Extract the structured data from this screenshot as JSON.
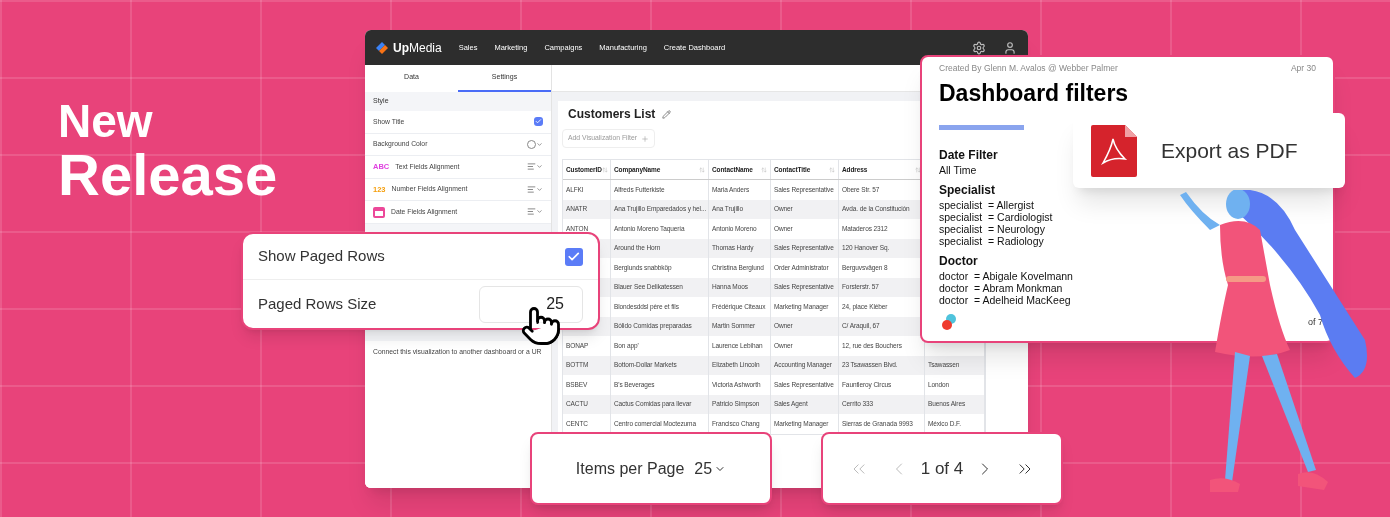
{
  "headline": {
    "line_1": "New",
    "line_2": "Release"
  },
  "app": {
    "brand": "**Up**Media",
    "nav": [
      "Sales",
      "Marketing",
      "Campaigns",
      "Manufacturing",
      "Create Dashboard"
    ],
    "panel_tabs": [
      {
        "label": "Data",
        "selected": false
      },
      {
        "label": "Settings",
        "selected": true
      }
    ],
    "settings": {
      "section": "Style",
      "items": [
        {
          "kind": "checkbox",
          "label": "Show Title",
          "checked": true
        },
        {
          "kind": "color",
          "label": "Background Color"
        },
        {
          "kind": "align",
          "label": "Text Fields Alignment",
          "badge": "ABC",
          "color": "#e040e0"
        },
        {
          "kind": "align",
          "label": "Number Fields Alignment",
          "badge": "123",
          "color": "#f59e0b"
        },
        {
          "kind": "align",
          "label": "Date Fields Alignment",
          "color": "#ec4899"
        }
      ],
      "link_note": "Connect this visualization to another dashboard or a UR"
    },
    "visualization": {
      "title": "Customers List",
      "filter_placeholder": "Add Visualization Filter",
      "columns": [
        "CustomerID",
        "CompanyName",
        "ContactName",
        "ContactTitle",
        "Address"
      ],
      "rows": [
        {
          "id": "ALFKI",
          "company": "Alfreds Futterkiste",
          "contact": "Maria Anders",
          "title": "Sales Representative",
          "address": "Obere Str. 57"
        },
        {
          "id": "ANATR",
          "company": "Ana Trujillo Emparedados y hel...",
          "contact": "Ana Trujillo",
          "title": "Owner",
          "address": "Avda. de la Constitución"
        },
        {
          "id": "ANTON",
          "company": "Antonio Moreno Taquería",
          "contact": "Antonio Moreno",
          "title": "Owner",
          "address": "Mataderos 2312"
        },
        {
          "company": "Around the Horn",
          "contact": "Thomas Hardy",
          "title": "Sales Representative",
          "address": "120 Hanover Sq."
        },
        {
          "company": "Berglunds snabbköp",
          "contact": "Christina Berglund",
          "title": "Order Administrator",
          "address": "Berguvsvägen 8"
        },
        {
          "company": "Blauer See Delikatessen",
          "contact": "Hanna Moos",
          "title": "Sales Representative",
          "address": "Forsterstr. 57"
        },
        {
          "company": "Blondesddsl père et fils",
          "contact": "Frédérique Citeaux",
          "title": "Marketing Manager",
          "address": "24, place Kléber"
        },
        {
          "company": "Bólido Comidas preparadas",
          "contact": "Martin Sommer",
          "title": "Owner",
          "address": "C/ Araquil, 67"
        },
        {
          "id": "BONAP",
          "company": "Bon app'",
          "contact": "Laurence Lebihan",
          "title": "Owner",
          "address": "12, rue des Bouchers"
        },
        {
          "id": "BOTTM",
          "company": "Bottom-Dollar Markets",
          "contact": "Elizabeth Lincoln",
          "title": "Accounting Manager",
          "address": "23 Tsawassen Blvd.",
          "city": "Tsawassen"
        },
        {
          "id": "BSBEV",
          "company": "B's Beverages",
          "contact": "Victoria Ashworth",
          "title": "Sales Representative",
          "address": "Fauntleroy Circus",
          "city": "London"
        },
        {
          "id": "CACTU",
          "company": "Cactus Comidas para llevar",
          "contact": "Patricio Simpson",
          "title": "Sales Agent",
          "address": "Cerrito 333",
          "city": "Buenos Aires"
        },
        {
          "id": "CENTC",
          "company": "Centro comercial Moctezuma",
          "contact": "Francisco Chang",
          "title": "Marketing Manager",
          "address": "Sierras de Granada 9993",
          "city": "México D.F."
        }
      ]
    }
  },
  "paged_rows_card": {
    "show_label": "Show Paged Rows",
    "checked": true,
    "size_label": "Paged Rows Size",
    "size_value": "25"
  },
  "items_per_page": {
    "label": "Items per Page",
    "value": "25"
  },
  "pagination": {
    "page": "1 of 4"
  },
  "filters_card": {
    "created_by": "Created By Glenn M. Avalos @ Webber Palmer",
    "date": "Apr 30",
    "title": "Dashboard filters",
    "sections": [
      {
        "heading": "Date Filter",
        "lines": [
          "All Time"
        ]
      },
      {
        "heading": "Specialist",
        "lines": [
          "specialist  = Allergist",
          "specialist  = Cardiologist",
          "specialist  = Neurology",
          "specialist  = Radiology"
        ]
      },
      {
        "heading": "Doctor",
        "lines": [
          "doctor  = Abigale Kovelmann",
          "doctor  = Abram Monkman",
          "doctor  = Adelheid MacKeeg"
        ]
      }
    ],
    "page_count": "of 7"
  },
  "export_button": {
    "label": "Export as PDF"
  }
}
